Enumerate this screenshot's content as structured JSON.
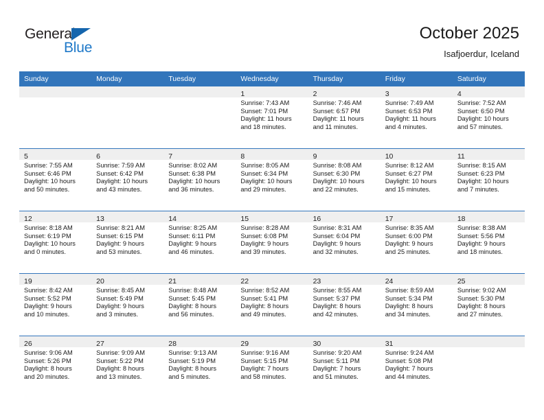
{
  "brand": {
    "name_top": "General",
    "name_bottom": "Blue",
    "triangle_icon": "triangle-icon",
    "colors": {
      "dark": "#231f20",
      "blue": "#1e78c8",
      "triangle": "#1565ad"
    }
  },
  "header": {
    "title": "October 2025",
    "subtitle": "Isafjoerdur, Iceland"
  },
  "calendar": {
    "header_bg": "#3275bb",
    "daynum_bg": "#efefef",
    "weekday_headers": [
      "Sunday",
      "Monday",
      "Tuesday",
      "Wednesday",
      "Thursday",
      "Friday",
      "Saturday"
    ],
    "labels": {
      "sunrise": "Sunrise:",
      "sunset": "Sunset:",
      "daylight": "Daylight:"
    },
    "weeks": [
      [
        {
          "day": "",
          "sunrise": "",
          "sunset": "",
          "daylight_line1": "",
          "daylight_line2": ""
        },
        {
          "day": "",
          "sunrise": "",
          "sunset": "",
          "daylight_line1": "",
          "daylight_line2": ""
        },
        {
          "day": "",
          "sunrise": "",
          "sunset": "",
          "daylight_line1": "",
          "daylight_line2": ""
        },
        {
          "day": "1",
          "sunrise": "Sunrise: 7:43 AM",
          "sunset": "Sunset: 7:01 PM",
          "daylight_line1": "Daylight: 11 hours",
          "daylight_line2": "and 18 minutes."
        },
        {
          "day": "2",
          "sunrise": "Sunrise: 7:46 AM",
          "sunset": "Sunset: 6:57 PM",
          "daylight_line1": "Daylight: 11 hours",
          "daylight_line2": "and 11 minutes."
        },
        {
          "day": "3",
          "sunrise": "Sunrise: 7:49 AM",
          "sunset": "Sunset: 6:53 PM",
          "daylight_line1": "Daylight: 11 hours",
          "daylight_line2": "and 4 minutes."
        },
        {
          "day": "4",
          "sunrise": "Sunrise: 7:52 AM",
          "sunset": "Sunset: 6:50 PM",
          "daylight_line1": "Daylight: 10 hours",
          "daylight_line2": "and 57 minutes."
        }
      ],
      [
        {
          "day": "5",
          "sunrise": "Sunrise: 7:55 AM",
          "sunset": "Sunset: 6:46 PM",
          "daylight_line1": "Daylight: 10 hours",
          "daylight_line2": "and 50 minutes."
        },
        {
          "day": "6",
          "sunrise": "Sunrise: 7:59 AM",
          "sunset": "Sunset: 6:42 PM",
          "daylight_line1": "Daylight: 10 hours",
          "daylight_line2": "and 43 minutes."
        },
        {
          "day": "7",
          "sunrise": "Sunrise: 8:02 AM",
          "sunset": "Sunset: 6:38 PM",
          "daylight_line1": "Daylight: 10 hours",
          "daylight_line2": "and 36 minutes."
        },
        {
          "day": "8",
          "sunrise": "Sunrise: 8:05 AM",
          "sunset": "Sunset: 6:34 PM",
          "daylight_line1": "Daylight: 10 hours",
          "daylight_line2": "and 29 minutes."
        },
        {
          "day": "9",
          "sunrise": "Sunrise: 8:08 AM",
          "sunset": "Sunset: 6:30 PM",
          "daylight_line1": "Daylight: 10 hours",
          "daylight_line2": "and 22 minutes."
        },
        {
          "day": "10",
          "sunrise": "Sunrise: 8:12 AM",
          "sunset": "Sunset: 6:27 PM",
          "daylight_line1": "Daylight: 10 hours",
          "daylight_line2": "and 15 minutes."
        },
        {
          "day": "11",
          "sunrise": "Sunrise: 8:15 AM",
          "sunset": "Sunset: 6:23 PM",
          "daylight_line1": "Daylight: 10 hours",
          "daylight_line2": "and 7 minutes."
        }
      ],
      [
        {
          "day": "12",
          "sunrise": "Sunrise: 8:18 AM",
          "sunset": "Sunset: 6:19 PM",
          "daylight_line1": "Daylight: 10 hours",
          "daylight_line2": "and 0 minutes."
        },
        {
          "day": "13",
          "sunrise": "Sunrise: 8:21 AM",
          "sunset": "Sunset: 6:15 PM",
          "daylight_line1": "Daylight: 9 hours",
          "daylight_line2": "and 53 minutes."
        },
        {
          "day": "14",
          "sunrise": "Sunrise: 8:25 AM",
          "sunset": "Sunset: 6:11 PM",
          "daylight_line1": "Daylight: 9 hours",
          "daylight_line2": "and 46 minutes."
        },
        {
          "day": "15",
          "sunrise": "Sunrise: 8:28 AM",
          "sunset": "Sunset: 6:08 PM",
          "daylight_line1": "Daylight: 9 hours",
          "daylight_line2": "and 39 minutes."
        },
        {
          "day": "16",
          "sunrise": "Sunrise: 8:31 AM",
          "sunset": "Sunset: 6:04 PM",
          "daylight_line1": "Daylight: 9 hours",
          "daylight_line2": "and 32 minutes."
        },
        {
          "day": "17",
          "sunrise": "Sunrise: 8:35 AM",
          "sunset": "Sunset: 6:00 PM",
          "daylight_line1": "Daylight: 9 hours",
          "daylight_line2": "and 25 minutes."
        },
        {
          "day": "18",
          "sunrise": "Sunrise: 8:38 AM",
          "sunset": "Sunset: 5:56 PM",
          "daylight_line1": "Daylight: 9 hours",
          "daylight_line2": "and 18 minutes."
        }
      ],
      [
        {
          "day": "19",
          "sunrise": "Sunrise: 8:42 AM",
          "sunset": "Sunset: 5:52 PM",
          "daylight_line1": "Daylight: 9 hours",
          "daylight_line2": "and 10 minutes."
        },
        {
          "day": "20",
          "sunrise": "Sunrise: 8:45 AM",
          "sunset": "Sunset: 5:49 PM",
          "daylight_line1": "Daylight: 9 hours",
          "daylight_line2": "and 3 minutes."
        },
        {
          "day": "21",
          "sunrise": "Sunrise: 8:48 AM",
          "sunset": "Sunset: 5:45 PM",
          "daylight_line1": "Daylight: 8 hours",
          "daylight_line2": "and 56 minutes."
        },
        {
          "day": "22",
          "sunrise": "Sunrise: 8:52 AM",
          "sunset": "Sunset: 5:41 PM",
          "daylight_line1": "Daylight: 8 hours",
          "daylight_line2": "and 49 minutes."
        },
        {
          "day": "23",
          "sunrise": "Sunrise: 8:55 AM",
          "sunset": "Sunset: 5:37 PM",
          "daylight_line1": "Daylight: 8 hours",
          "daylight_line2": "and 42 minutes."
        },
        {
          "day": "24",
          "sunrise": "Sunrise: 8:59 AM",
          "sunset": "Sunset: 5:34 PM",
          "daylight_line1": "Daylight: 8 hours",
          "daylight_line2": "and 34 minutes."
        },
        {
          "day": "25",
          "sunrise": "Sunrise: 9:02 AM",
          "sunset": "Sunset: 5:30 PM",
          "daylight_line1": "Daylight: 8 hours",
          "daylight_line2": "and 27 minutes."
        }
      ],
      [
        {
          "day": "26",
          "sunrise": "Sunrise: 9:06 AM",
          "sunset": "Sunset: 5:26 PM",
          "daylight_line1": "Daylight: 8 hours",
          "daylight_line2": "and 20 minutes."
        },
        {
          "day": "27",
          "sunrise": "Sunrise: 9:09 AM",
          "sunset": "Sunset: 5:22 PM",
          "daylight_line1": "Daylight: 8 hours",
          "daylight_line2": "and 13 minutes."
        },
        {
          "day": "28",
          "sunrise": "Sunrise: 9:13 AM",
          "sunset": "Sunset: 5:19 PM",
          "daylight_line1": "Daylight: 8 hours",
          "daylight_line2": "and 5 minutes."
        },
        {
          "day": "29",
          "sunrise": "Sunrise: 9:16 AM",
          "sunset": "Sunset: 5:15 PM",
          "daylight_line1": "Daylight: 7 hours",
          "daylight_line2": "and 58 minutes."
        },
        {
          "day": "30",
          "sunrise": "Sunrise: 9:20 AM",
          "sunset": "Sunset: 5:11 PM",
          "daylight_line1": "Daylight: 7 hours",
          "daylight_line2": "and 51 minutes."
        },
        {
          "day": "31",
          "sunrise": "Sunrise: 9:24 AM",
          "sunset": "Sunset: 5:08 PM",
          "daylight_line1": "Daylight: 7 hours",
          "daylight_line2": "and 44 minutes."
        },
        {
          "day": "",
          "sunrise": "",
          "sunset": "",
          "daylight_line1": "",
          "daylight_line2": ""
        }
      ]
    ]
  }
}
